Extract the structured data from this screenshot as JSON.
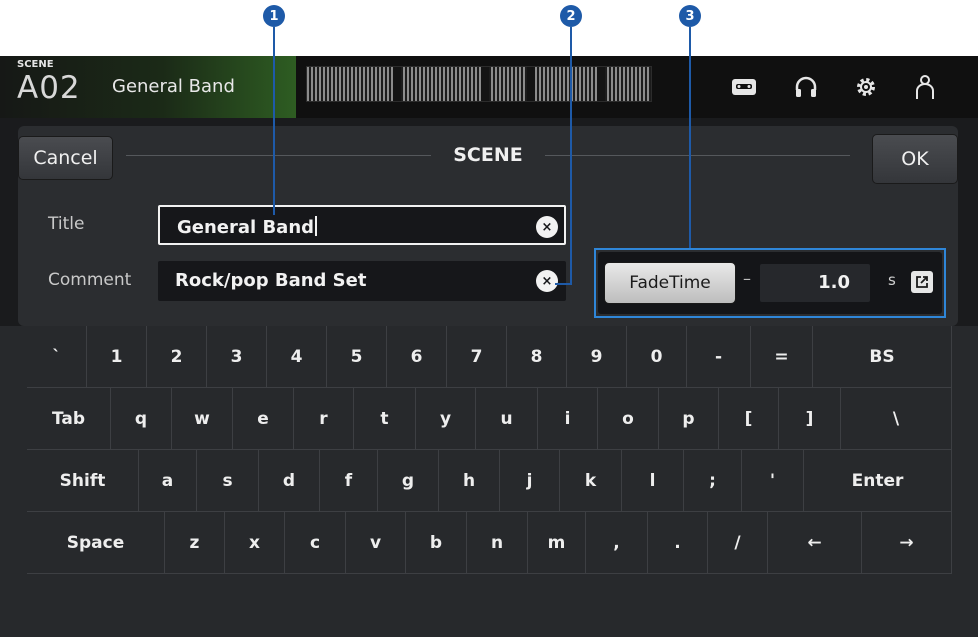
{
  "callouts": [
    "1",
    "2",
    "3"
  ],
  "header": {
    "scene_tag": "SCENE",
    "scene_number": "A02",
    "scene_name": "General Band",
    "icons": [
      "recorder-icon",
      "headphones-icon",
      "settings-gear-icon",
      "user-icon"
    ]
  },
  "dialog": {
    "title": "SCENE",
    "cancel_label": "Cancel",
    "ok_label": "OK",
    "title_label": "Title",
    "title_value": "General Band",
    "comment_label": "Comment",
    "comment_value": "Rock/pop Band Set",
    "clear_symbol": "×",
    "fade": {
      "button_label": "FadeTime",
      "separator": "–",
      "value": "1.0",
      "unit": "s",
      "popup_icon": "external-link-icon"
    }
  },
  "keyboard": {
    "rows": [
      [
        "`",
        "1",
        "2",
        "3",
        "4",
        "5",
        "6",
        "7",
        "8",
        "9",
        "0",
        "-",
        "=",
        "BS"
      ],
      [
        "Tab",
        "q",
        "w",
        "e",
        "r",
        "t",
        "y",
        "u",
        "i",
        "o",
        "p",
        "[",
        "]",
        "\\"
      ],
      [
        "Shift",
        "a",
        "s",
        "d",
        "f",
        "g",
        "h",
        "j",
        "k",
        "l",
        ";",
        "'",
        "Enter"
      ],
      [
        "Space",
        "z",
        "x",
        "c",
        "v",
        "b",
        "n",
        "m",
        ",",
        ".",
        "/",
        "←",
        "→"
      ]
    ]
  },
  "colors": {
    "accent": "#1e5aa8",
    "highlight_box": "#2f86d8",
    "scene_green": "#2e5d22"
  }
}
